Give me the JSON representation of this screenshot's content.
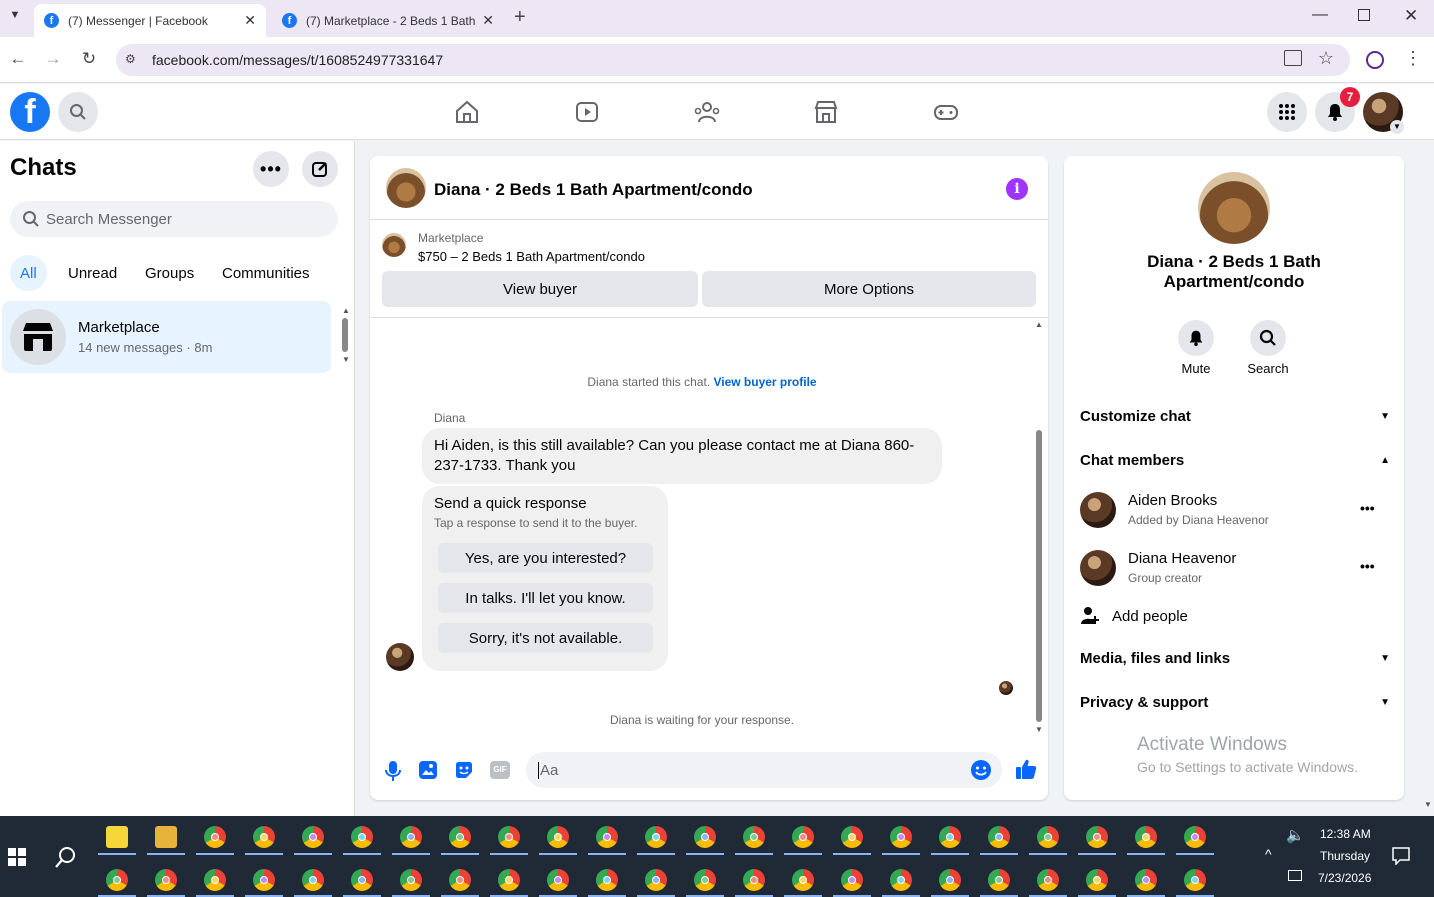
{
  "browser": {
    "tabs": [
      {
        "title": "(7) Messenger | Facebook",
        "active": true
      },
      {
        "title": "(7) Marketplace - 2 Beds 1 Bath",
        "active": false
      }
    ],
    "url": "facebook.com/messages/t/1608524977331647"
  },
  "header": {
    "notification_count": "7"
  },
  "sidebar": {
    "title": "Chats",
    "search_placeholder": "Search Messenger",
    "filters": [
      "All",
      "Unread",
      "Groups",
      "Communities"
    ],
    "active_filter": "All",
    "chats": [
      {
        "name": "Marketplace",
        "preview": "14 new messages",
        "time": "8m"
      }
    ]
  },
  "conversation": {
    "title": "Diana · 2 Beds 1 Bath Apartment/condo",
    "listing": {
      "source": "Marketplace",
      "summary": "$750 – 2 Beds 1 Bath Apartment/condo"
    },
    "view_buyer_label": "View buyer",
    "more_options_label": "More Options",
    "started_text": "Diana started this chat.",
    "view_buyer_profile_link": "View buyer profile",
    "sender_name": "Diana",
    "message": "Hi Aiden, is this still available? Can you please contact me at Diana 860-237-1733.  Thank you",
    "quick_response": {
      "title": "Send a quick response",
      "subtitle": "Tap a response to send it to the buyer.",
      "options": [
        "Yes, are you interested?",
        "In talks. I'll let you know.",
        "Sorry, it's not available."
      ]
    },
    "waiting_text": "Diana is waiting for your response.",
    "composer_placeholder": "Aa"
  },
  "details": {
    "name": "Diana · 2 Beds 1 Bath Apartment/condo",
    "actions": [
      {
        "label": "Mute",
        "icon": "bell-icon"
      },
      {
        "label": "Search",
        "icon": "search-icon"
      }
    ],
    "sections": {
      "customize": "Customize chat",
      "members": "Chat members",
      "media": "Media, files and links",
      "privacy": "Privacy & support"
    },
    "members": [
      {
        "name": "Aiden Brooks",
        "sub": "Added by Diana Heavenor"
      },
      {
        "name": "Diana Heavenor",
        "sub": "Group creator"
      }
    ],
    "add_people": "Add people"
  },
  "watermark": {
    "line1": "Activate Windows",
    "line2": "Go to Settings to activate Windows."
  },
  "taskbar": {
    "time": "12:38 AM",
    "day": "Thursday",
    "date": "7/23/2026"
  },
  "colors": {
    "fb_blue": "#1877f2",
    "messenger_purple": "#a033ff",
    "badge_red": "#e41e3f"
  }
}
